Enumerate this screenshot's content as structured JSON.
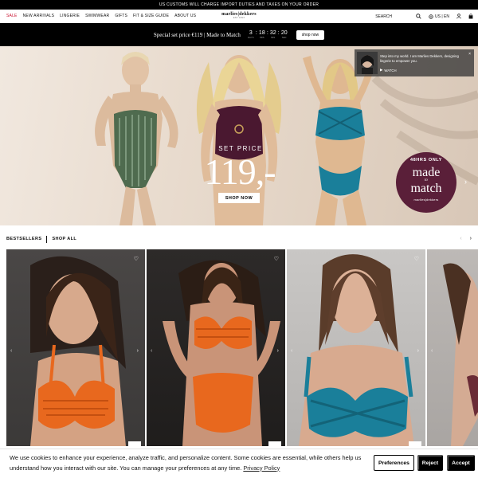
{
  "announcement": "US CUSTOMS WILL CHARGE IMPORT DUTIES AND TAXES ON YOUR ORDER",
  "nav": {
    "items": [
      "SALE",
      "NEW ARRIVALS",
      "LINGERIE",
      "SWIMWEAR",
      "GIFTS",
      "FIT & SIZE GUIDE",
      "ABOUT US"
    ]
  },
  "logo": {
    "name": "marlies|dekkers",
    "sub": "EST 1993"
  },
  "header_right": {
    "search": "SEARCH",
    "locale": "US | EN"
  },
  "promo": {
    "text": "Special set price €119 | Made to Match",
    "timer": [
      {
        "value": "3",
        "label": "DAYS"
      },
      {
        "value": "18",
        "label": "HRS"
      },
      {
        "value": "32",
        "label": "MIN"
      },
      {
        "value": "20",
        "label": "SEC"
      }
    ],
    "button": "shop now"
  },
  "hero": {
    "price_label": "SET PRICE",
    "price": "119,-",
    "button": "SHOP NOW",
    "badge": {
      "top": "48HRS ONLY",
      "line1": "made",
      "to": "to",
      "line2": "match",
      "brand": "marlies|dekkers"
    }
  },
  "video_popup": {
    "message": "Step into my world. I am Marlies Dekkers, designing lingerie to empower you.",
    "watch": "WATCH",
    "close": "×"
  },
  "bestsellers": {
    "title": "BESTSELLERS",
    "shop_all": "SHOP ALL"
  },
  "products": [
    {
      "name": "product-card-1"
    },
    {
      "name": "product-card-2"
    },
    {
      "name": "product-card-3"
    },
    {
      "name": "product-card-4"
    }
  ],
  "cookie": {
    "text": "We use cookies to enhance your experience, analyze traffic, and personalize content. Some cookies are essential, while others help us understand how you interact with our site. You can manage your preferences at any time.",
    "policy_link": "Privacy Policy",
    "preferences": "Preferences",
    "reject": "Reject",
    "accept": "Accept"
  },
  "colors": {
    "sale": "#c8102e",
    "badge": "#5a1f39",
    "swim_orange": "#e8681e",
    "swim_teal": "#1a7f9a",
    "swim_green": "#4f6b4f",
    "swim_plum": "#4a1830"
  }
}
